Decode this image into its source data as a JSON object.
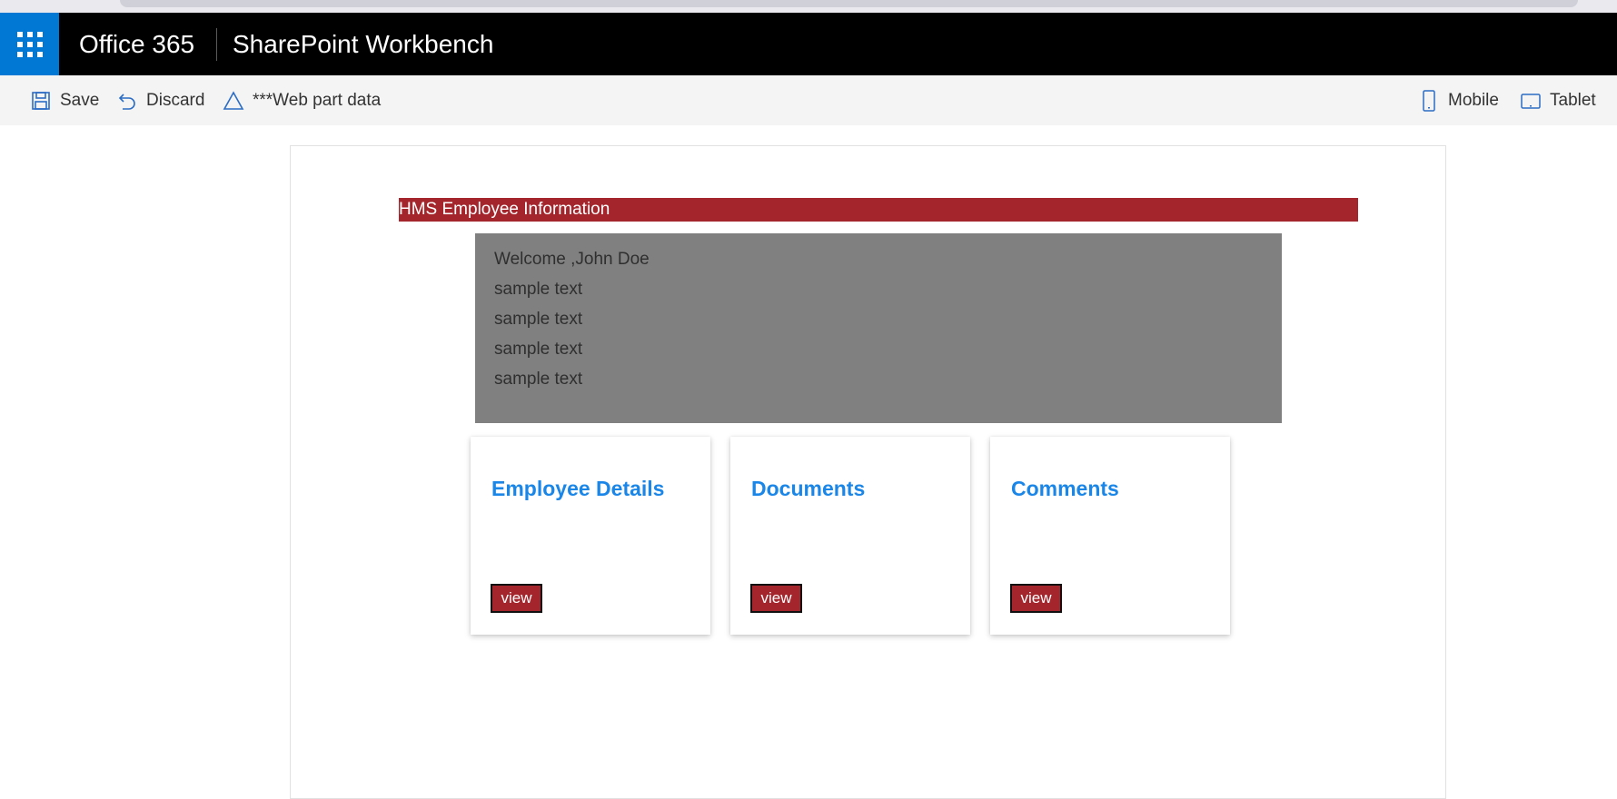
{
  "suite_bar": {
    "brand": "Office 365",
    "app_title": "SharePoint Workbench",
    "accent_color": "#0078d4"
  },
  "command_bar": {
    "save_label": "Save",
    "discard_label": "Discard",
    "webpart_label": "***Web part data",
    "mobile_label": "Mobile",
    "tablet_label": "Tablet"
  },
  "webpart": {
    "header_title": "HMS Employee Information",
    "header_color": "#a4262c",
    "welcome_lines": [
      "Welcome ,John Doe",
      "sample text",
      "sample text",
      "sample text",
      "sample text"
    ],
    "cards": [
      {
        "title": "Employee Details",
        "button": "view"
      },
      {
        "title": "Documents",
        "button": "view"
      },
      {
        "title": "Comments",
        "button": "view"
      }
    ]
  }
}
